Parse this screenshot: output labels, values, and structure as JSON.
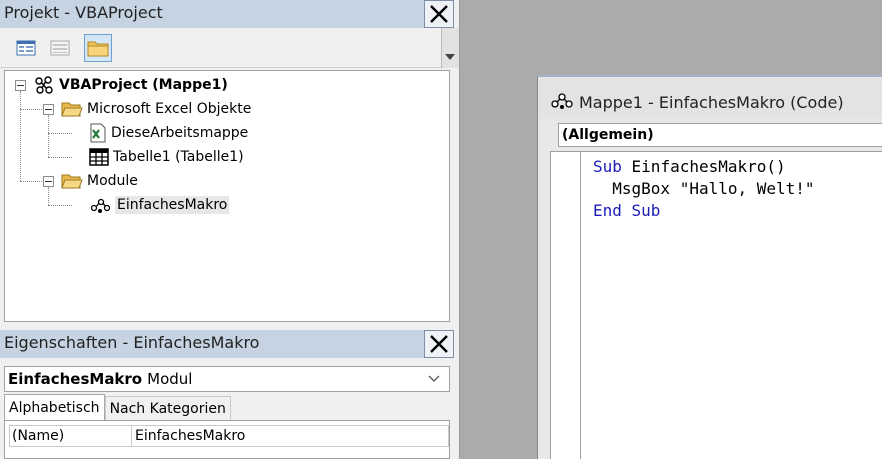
{
  "project": {
    "title": "Projekt - VBAProject",
    "tree": {
      "root": "VBAProject (Mappe1)",
      "excel_objects": "Microsoft Excel Objekte",
      "workbook": "DieseArbeitsmappe",
      "sheet": "Tabelle1 (Tabelle1)",
      "modules": "Module",
      "module_item": "EinfachesMakro"
    }
  },
  "properties": {
    "title": "Eigenschaften - EinfachesMakro",
    "object_name": "EinfachesMakro",
    "object_type": "Modul",
    "tabs": [
      "Alphabetisch",
      "Nach Kategorien"
    ],
    "rows": [
      {
        "name": "(Name)",
        "value": "EinfachesMakro"
      }
    ]
  },
  "code_window": {
    "title": "Mappe1 - EinfachesMakro (Code)",
    "object_combo": "(Allgemein)",
    "code": {
      "line1_kw": "Sub",
      "line1_rest": " EinfachesMakro()",
      "line2": "  MsgBox \"Hallo, Welt!\"",
      "line3": "End Sub"
    }
  },
  "colors": {
    "titlebar": "#c5d3e2",
    "keyword": "#1b1bb8",
    "workspace": "#ababab"
  }
}
